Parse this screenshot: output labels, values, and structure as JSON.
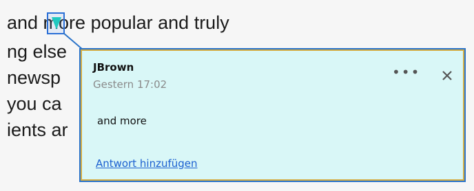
{
  "document": {
    "lines": [
      "and  more popular and truly",
      "ng else",
      " newsp",
      " you ca",
      "ients ar"
    ]
  },
  "comment": {
    "author": "JBrown",
    "timestamp": "Gestern 17:02",
    "text": "and more",
    "reply_label": "Antwort hinzufügen",
    "more_icon": "more-horizontal-icon",
    "close_icon": "close-icon"
  },
  "colors": {
    "card_background": "#d9f7f7",
    "card_border": "#2a73c9",
    "card_inner_border": "#d4ad43",
    "link": "#1a5fd0",
    "anchor_marker": "#1fc9c0"
  }
}
